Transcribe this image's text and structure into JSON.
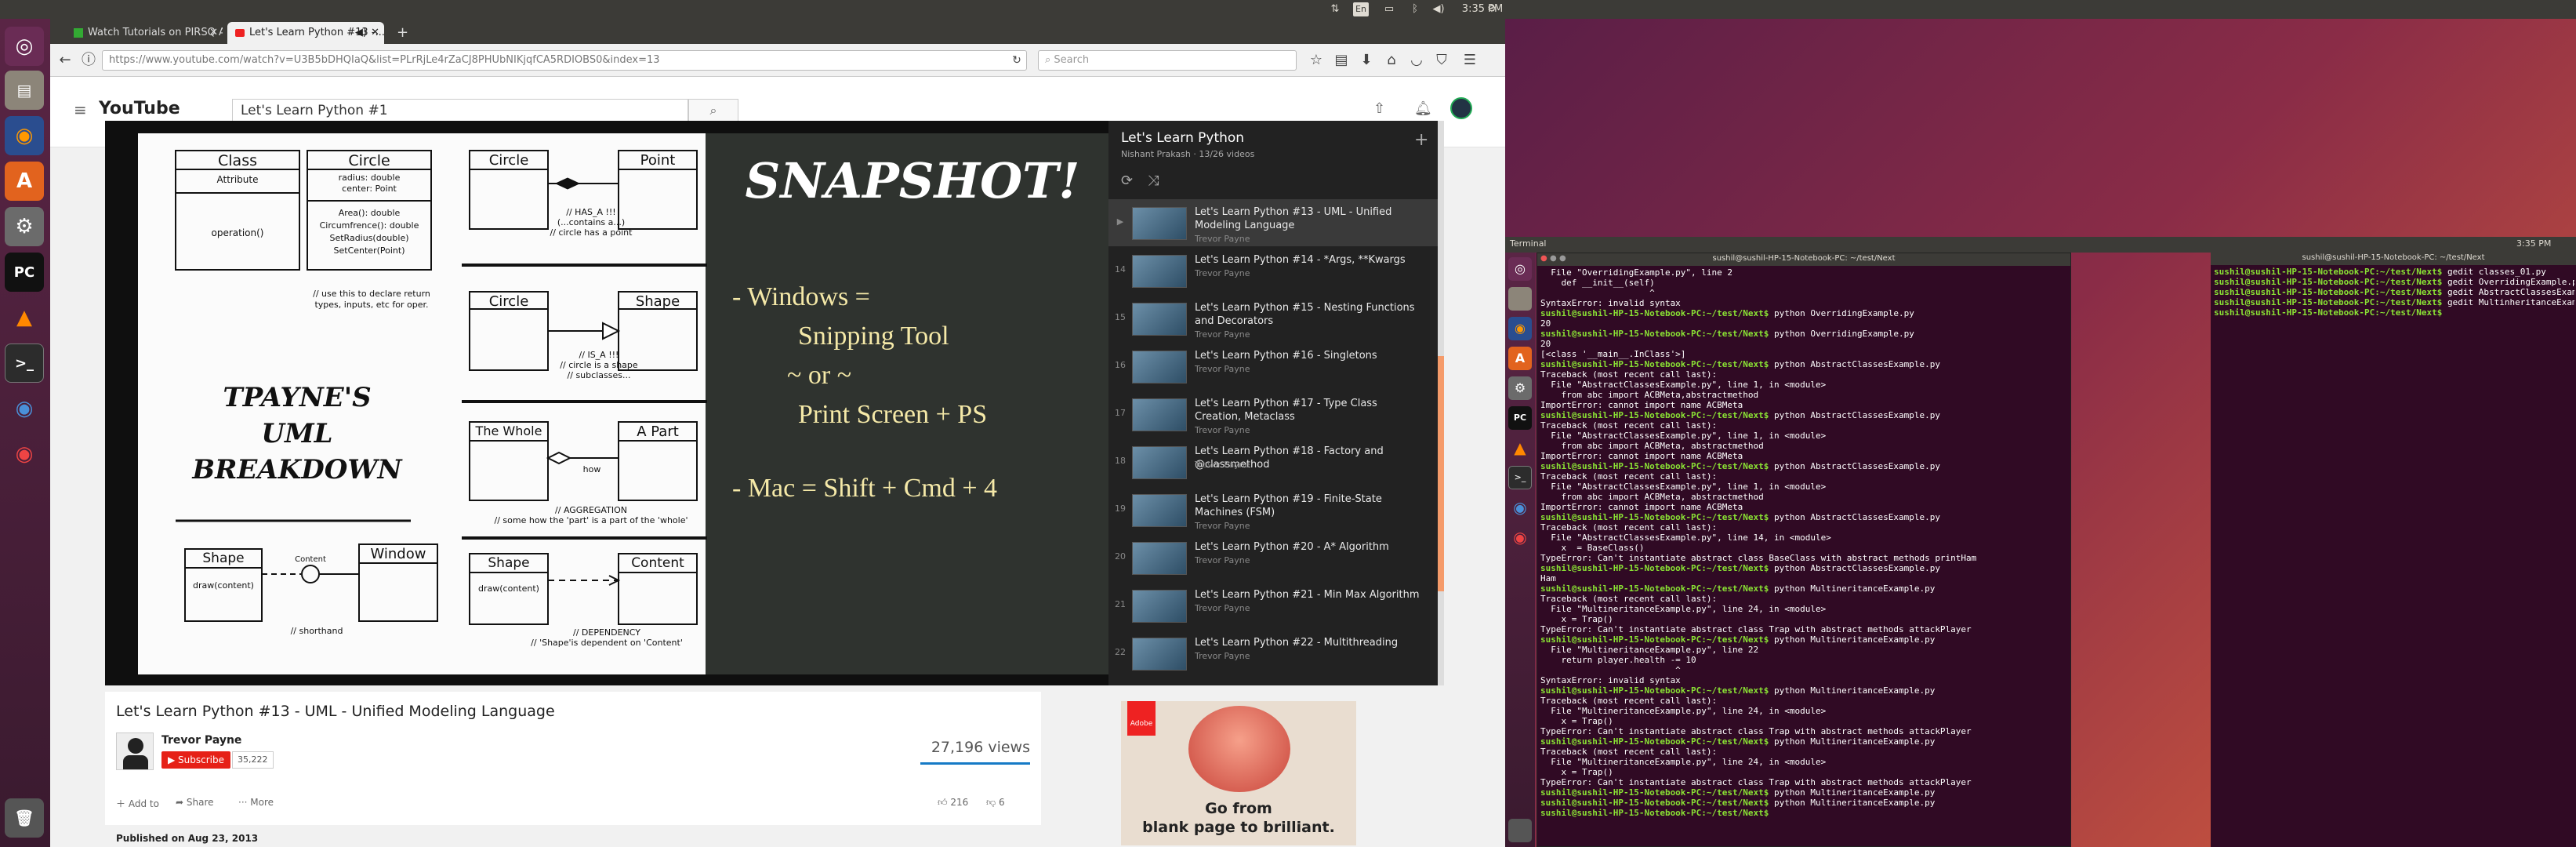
{
  "panel": {
    "time": "3:35 PM",
    "keyboard": "En"
  },
  "launcher": {
    "items": [
      "Dash",
      "Files",
      "Firefox",
      "Ubuntu Software",
      "System Settings",
      "PyCharm",
      "VLC",
      "Terminal",
      "Chromium",
      "Google Chrome",
      "Trash"
    ]
  },
  "browser": {
    "tabs": [
      {
        "title": "Watch Tutorials on PIRSQ A..."
      },
      {
        "title": "Let's Learn Python #13 -..."
      }
    ],
    "url": "https://www.youtube.com/watch?v=U3B5bDHQIaQ&list=PLrRjLe4rZaCJ8PHUbNIKjqfCA5RDIOBS0&index=13",
    "search_placeholder": "Search"
  },
  "youtube": {
    "logo": "YouTube",
    "search_value": "Let's Learn Python #1",
    "video": {
      "title": "Let's Learn Python #13 - UML - Unified Modeling Language",
      "channel": "Trevor Payne",
      "subscribe_label": "Subscribe",
      "subscriber_count": "35,222",
      "views": "27,196 views",
      "likes": "216",
      "dislikes": "6",
      "add_to": "Add to",
      "share": "Share",
      "more": "More",
      "published": "Published on Aug 23, 2013"
    },
    "slide": {
      "class_label": "Class",
      "attribute_label": "Attribute",
      "operation_label": "operation()",
      "circle_label": "Circle",
      "circle_attrs": [
        "radius: double",
        "center: Point"
      ],
      "circle_ops": [
        "Area(): double",
        "Circumfrence(): double",
        "SetRadius(double)",
        "SetCenter(Point)"
      ],
      "class_note": [
        "// use this to declare return",
        "types, inputs, etc for oper."
      ],
      "brand_lines": [
        "TPAYNE'S",
        "UML BREAKDOWN"
      ],
      "shape_label": "Shape",
      "shape_op": "draw(content)",
      "content_label": "Content",
      "window_label": "Window",
      "shorthand_note": "// shorthand",
      "has_a_notes": [
        "// HAS_A !!!",
        "(...contains a...)",
        "// circle has a point"
      ],
      "point_label": "Point",
      "is_a_notes": [
        "// IS_A !!!",
        "// circle is a shape",
        "// subclasses..."
      ],
      "whole_label": "The Whole",
      "part_label": "A Part",
      "how_label": "how",
      "aggregation_notes": [
        "// AGGREGATION",
        "// some how the 'part' is a part of the 'whole'"
      ],
      "dependency_notes": [
        "// DEPENDENCY",
        "// 'Shape'is dependent on 'Content'"
      ],
      "snapshot_title": "SNAPSHOT!",
      "snapshot_lines": [
        "- Windows =",
        "Snipping Tool",
        "~ or ~",
        "Print Screen + PS",
        "- Mac = Shift + Cmd + 4"
      ]
    },
    "playlist": {
      "title": "Let's Learn Python",
      "meta": "Nishant Prakash · 13/26 videos",
      "items": [
        {
          "idx": "▶",
          "title": "Let's Learn Python #13 - UML - Unified Modeling Language",
          "author": "Trevor Payne"
        },
        {
          "idx": "14",
          "title": "Let's Learn Python #14 - *Args, **Kwargs",
          "author": "Trevor Payne"
        },
        {
          "idx": "15",
          "title": "Let's Learn Python #15 - Nesting Functions and Decorators",
          "author": "Trevor Payne"
        },
        {
          "idx": "16",
          "title": "Let's Learn Python #16 - Singletons",
          "author": "Trevor Payne"
        },
        {
          "idx": "17",
          "title": "Let's Learn Python #17 - Type Class Creation, Metaclass",
          "author": "Trevor Payne"
        },
        {
          "idx": "18",
          "title": "Let's Learn Python #18 - Factory and @classmethod",
          "author": "Trevor Payne"
        },
        {
          "idx": "19",
          "title": "Let's Learn Python #19 - Finite-State Machines (FSM)",
          "author": "Trevor Payne"
        },
        {
          "idx": "20",
          "title": "Let's Learn Python #20 - A* Algorithm",
          "author": "Trevor Payne"
        },
        {
          "idx": "21",
          "title": "Let's Learn Python #21 - Min Max Algorithm",
          "author": "Trevor Payne"
        },
        {
          "idx": "22",
          "title": "Let's Learn Python #22 - Multithreading",
          "author": "Trevor Payne"
        }
      ]
    },
    "ad": {
      "brand": "Adobe",
      "headline": "Go from",
      "subline": "blank page to brilliant."
    }
  },
  "terminal": {
    "app_title": "Terminal",
    "time": "3:35 PM",
    "window_title": "sushil@sushil-HP-15-Notebook-PC: ~/test/Next",
    "lines": [
      "  File \"OverridingExample.py\", line 2",
      "    def __init__(self)",
      "                     ^",
      "SyntaxError: invalid syntax",
      "sushil@sushil-HP-15-Notebook-PC:~/test/Next$ python OverridingExample.py",
      "20",
      "sushil@sushil-HP-15-Notebook-PC:~/test/Next$ python OverridingExample.py",
      "20",
      "[<class '__main__.InClass'>]",
      "sushil@sushil-HP-15-Notebook-PC:~/test/Next$ python AbstractClassesExample.py",
      "Traceback (most recent call last):",
      "  File \"AbstractClassesExample.py\", line 1, in <module>",
      "    from abc import ACBMeta,abstractmethod",
      "ImportError: cannot import name ACBMeta",
      "sushil@sushil-HP-15-Notebook-PC:~/test/Next$ python AbstractClassesExample.py",
      "Traceback (most recent call last):",
      "  File \"AbstractClassesExample.py\", line 1, in <module>",
      "    from abc import ACBMeta, abstractmethod",
      "ImportError: cannot import name ACBMeta",
      "sushil@sushil-HP-15-Notebook-PC:~/test/Next$ python AbstractClassesExample.py",
      "Traceback (most recent call last):",
      "  File \"AbstractClassesExample.py\", line 1, in <module>",
      "    from abc import ACBMeta, abstractmethod",
      "ImportError: cannot import name ACBMeta",
      "sushil@sushil-HP-15-Notebook-PC:~/test/Next$ python AbstractClassesExample.py",
      "Traceback (most recent call last):",
      "  File \"AbstractClassesExample.py\", line 14, in <module>",
      "    x  = BaseClass()",
      "TypeError: Can't instantiate abstract class BaseClass with abstract methods printHam",
      "sushil@sushil-HP-15-Notebook-PC:~/test/Next$ python AbstractClassesExample.py",
      "Ham",
      "sushil@sushil-HP-15-Notebook-PC:~/test/Next$ python MultineritanceExample.py",
      "Traceback (most recent call last):",
      "  File \"MultineritanceExample.py\", line 24, in <module>",
      "    x = Trap()",
      "TypeError: Can't instantiate abstract class Trap with abstract methods attackPlayer",
      "sushil@sushil-HP-15-Notebook-PC:~/test/Next$ python MultineritanceExample.py",
      "  File \"MultineritanceExample.py\", line 22",
      "    return player.health -= 10",
      "                          ^",
      "SyntaxError: invalid syntax",
      "sushil@sushil-HP-15-Notebook-PC:~/test/Next$ python MultineritanceExample.py",
      "Traceback (most recent call last):",
      "  File \"MultineritanceExample.py\", line 24, in <module>",
      "    x = Trap()",
      "TypeError: Can't instantiate abstract class Trap with abstract methods attackPlayer",
      "sushil@sushil-HP-15-Notebook-PC:~/test/Next$ python MultineritanceExample.py",
      "Traceback (most recent call last):",
      "  File \"MultineritanceExample.py\", line 24, in <module>",
      "    x = Trap()",
      "TypeError: Can't instantiate abstract class Trap with abstract methods attackPlayer",
      "sushil@sushil-HP-15-Notebook-PC:~/test/Next$ python MultineritanceExample.py",
      "sushil@sushil-HP-15-Notebook-PC:~/test/Next$ python MultineritanceExample.py",
      "sushil@sushil-HP-15-Notebook-PC:~/test/Next$ "
    ],
    "side_title": "sushil@sushil-HP-15-Notebook-PC: ~/test/Next",
    "side_lines": [
      "sushil@sushil-HP-15-Notebook-PC:~/test/Next$ gedit classes_01.py",
      "sushil@sushil-HP-15-Notebook-PC:~/test/Next$ gedit OverridingExample.py",
      "sushil@sushil-HP-15-Notebook-PC:~/test/Next$ gedit AbstractClassesExample.py",
      "sushil@sushil-HP-15-Notebook-PC:~/test/Next$ gedit MultinheritanceExample.py",
      "sushil@sushil-HP-15-Notebook-PC:~/test/Next$ "
    ]
  }
}
